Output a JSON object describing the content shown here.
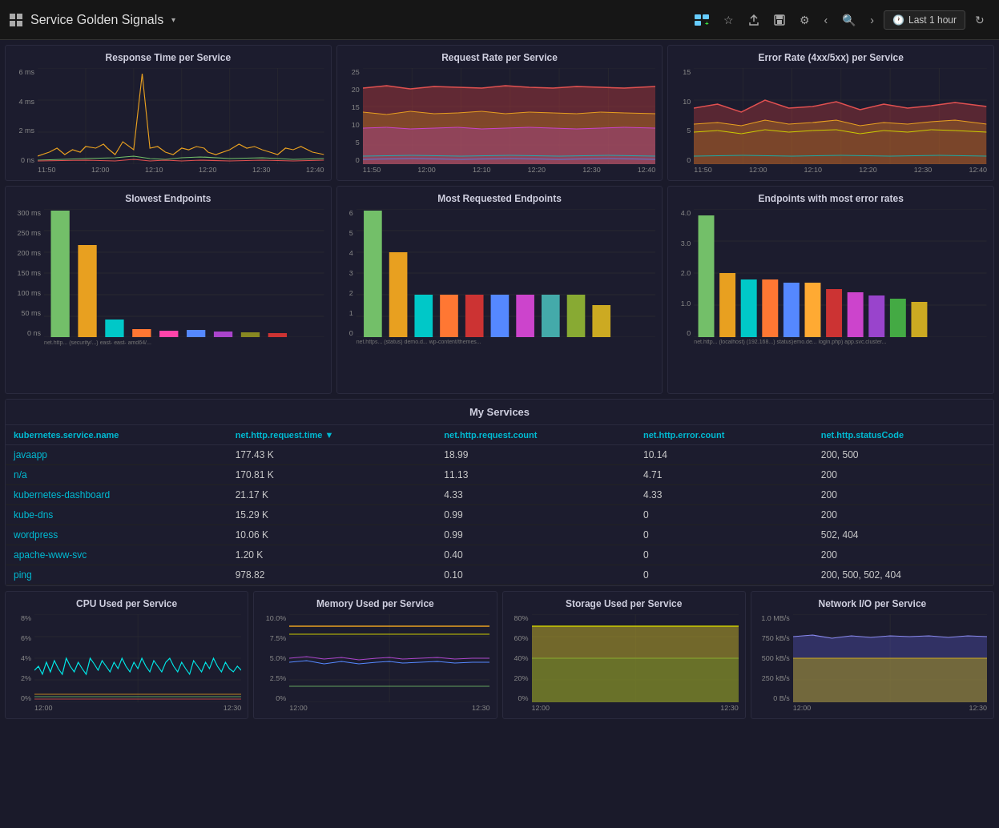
{
  "header": {
    "title": "Service Golden Signals",
    "dropdown_arrow": "▾",
    "time_range": "Last 1 hour",
    "icons": {
      "add_panel": "📊",
      "star": "☆",
      "share": "⬆",
      "save": "💾",
      "settings": "⚙",
      "prev": "‹",
      "search": "🔍",
      "next": "›",
      "clock": "🕐",
      "refresh": "↻"
    }
  },
  "charts_row1": [
    {
      "title": "Response Time per Service",
      "y_labels": [
        "6 ms",
        "4 ms",
        "2 ms",
        "0 ns"
      ],
      "x_labels": [
        "11:50",
        "12:00",
        "12:10",
        "12:20",
        "12:30",
        "12:40"
      ]
    },
    {
      "title": "Request Rate per Service",
      "y_labels": [
        "25",
        "20",
        "15",
        "10",
        "5",
        "0"
      ],
      "x_labels": [
        "11:50",
        "12:00",
        "12:10",
        "12:20",
        "12:30",
        "12:40"
      ]
    },
    {
      "title": "Error Rate (4xx/5xx) per Service",
      "y_labels": [
        "15",
        "10",
        "5",
        "0"
      ],
      "x_labels": [
        "11:50",
        "12:00",
        "12:10",
        "12:20",
        "12:30",
        "12:40"
      ]
    }
  ],
  "charts_row2": [
    {
      "title": "Slowest Endpoints",
      "y_labels": [
        "300 ms",
        "250 ms",
        "200 ms",
        "150 ms",
        "100 ms",
        "50 ms",
        "0 ns"
      ]
    },
    {
      "title": "Most Requested Endpoints",
      "y_labels": [
        "6",
        "5",
        "4",
        "3",
        "2",
        "1",
        "0"
      ]
    },
    {
      "title": "Endpoints with most error rates",
      "y_labels": [
        "4.0",
        "3.0",
        "2.0",
        "1.0",
        "0"
      ]
    }
  ],
  "services_table": {
    "title": "My Services",
    "columns": [
      {
        "label": "kubernetes.service.name",
        "color": "cyan"
      },
      {
        "label": "net.http.request.time ▼",
        "color": "cyan"
      },
      {
        "label": "net.http.request.count",
        "color": "cyan"
      },
      {
        "label": "net.http.error.count",
        "color": "cyan"
      },
      {
        "label": "net.http.statusCode",
        "color": "cyan"
      }
    ],
    "rows": [
      [
        "javaapp",
        "177.43 K",
        "18.99",
        "10.14",
        "200, 500"
      ],
      [
        "n/a",
        "170.81 K",
        "11.13",
        "4.71",
        "200"
      ],
      [
        "kubernetes-dashboard",
        "21.17 K",
        "4.33",
        "4.33",
        "200"
      ],
      [
        "kube-dns",
        "15.29 K",
        "0.99",
        "0",
        "200"
      ],
      [
        "wordpress",
        "10.06 K",
        "0.99",
        "0",
        "502, 404"
      ],
      [
        "apache-www-svc",
        "1.20 K",
        "0.40",
        "0",
        "200"
      ],
      [
        "ping",
        "978.82",
        "0.10",
        "0",
        "200, 500, 502, 404"
      ]
    ]
  },
  "charts_row3": [
    {
      "title": "CPU Used per Service",
      "y_labels": [
        "8%",
        "6%",
        "4%",
        "2%",
        "0%"
      ],
      "x_labels": [
        "12:00",
        "12:30"
      ]
    },
    {
      "title": "Memory Used per Service",
      "y_labels": [
        "10.0%",
        "7.5%",
        "5.0%",
        "2.5%",
        "0%"
      ],
      "x_labels": [
        "12:00",
        "12:30"
      ]
    },
    {
      "title": "Storage Used per Service",
      "y_labels": [
        "80%",
        "60%",
        "40%",
        "20%",
        "0%"
      ],
      "x_labels": [
        "12:00",
        "12:30"
      ]
    },
    {
      "title": "Network I/O per Service",
      "y_labels": [
        "1.0 MB/s",
        "750 kB/s",
        "500 kB/s",
        "250 kB/s",
        "0 B/s"
      ],
      "x_labels": [
        "12:00",
        "12:30"
      ]
    }
  ]
}
